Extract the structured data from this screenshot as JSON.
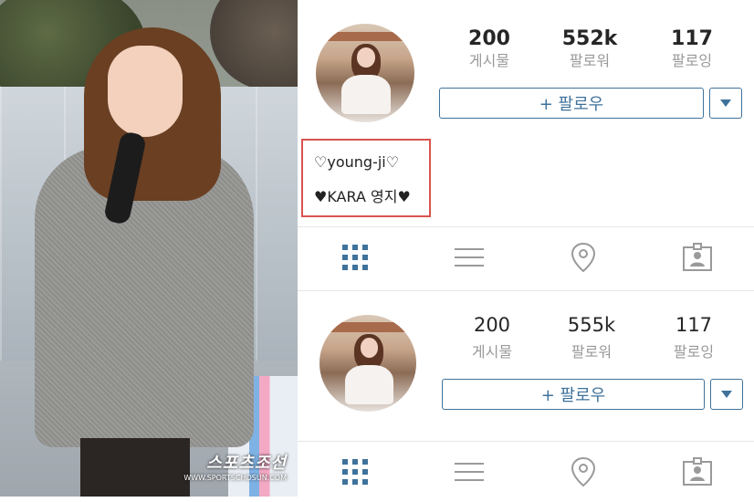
{
  "photo": {
    "watermark_title": "스포츠조선",
    "watermark_url": "WWW.SPORTSCHOSUN.COM"
  },
  "profile_top": {
    "stats": [
      {
        "value": "200",
        "label": "게시물"
      },
      {
        "value": "552k",
        "label": "팔로워"
      },
      {
        "value": "117",
        "label": "팔로잉"
      }
    ],
    "follow_label": "+ 팔로우",
    "bio_line1": "♡young-ji♡",
    "bio_line2": "♥KARA 영지♥"
  },
  "profile_bottom": {
    "stats": [
      {
        "value": "200",
        "label": "게시물"
      },
      {
        "value": "555k",
        "label": "팔로워"
      },
      {
        "value": "117",
        "label": "팔로잉"
      }
    ],
    "follow_label": "+ 팔로우"
  },
  "tabs": [
    {
      "icon": "grid-icon",
      "active": true
    },
    {
      "icon": "list-icon",
      "active": false
    },
    {
      "icon": "location-pin-icon",
      "active": false
    },
    {
      "icon": "tagged-person-icon",
      "active": false
    }
  ],
  "colors": {
    "accent": "#3f729b",
    "highlight_border": "#d9534f",
    "muted_text": "#999999",
    "inactive_icon": "#9a9a9a"
  }
}
